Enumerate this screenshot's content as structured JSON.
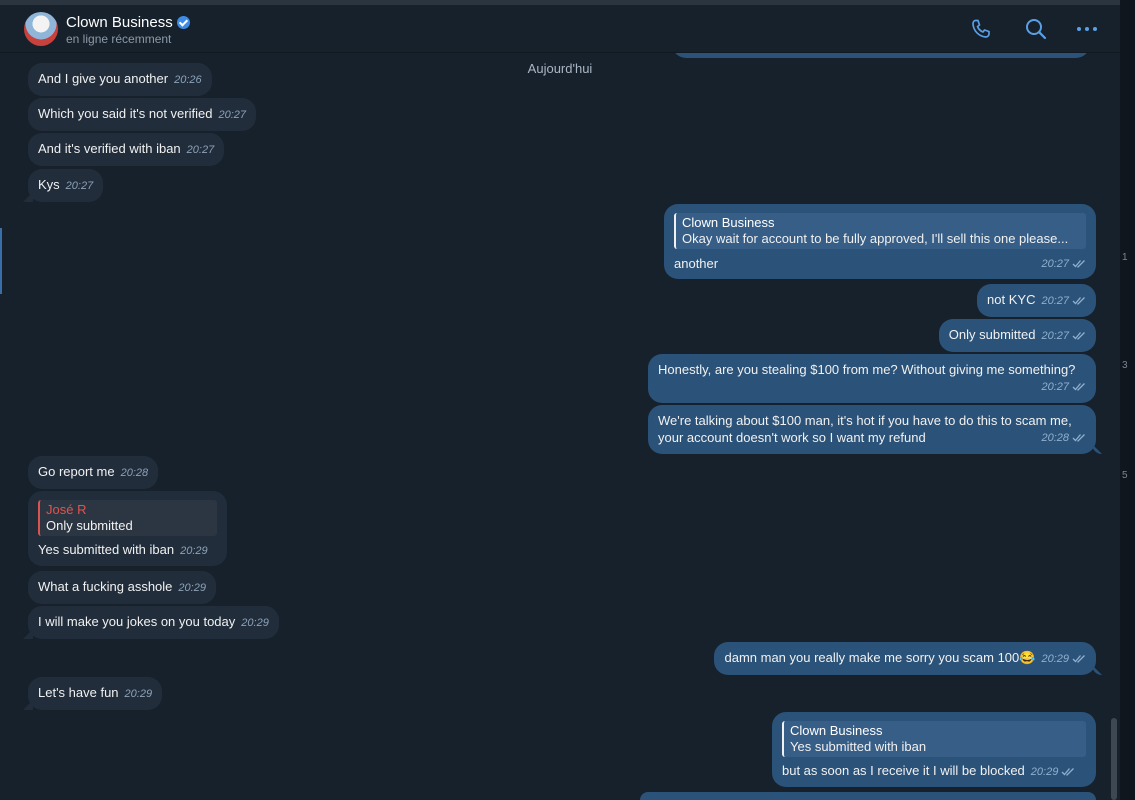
{
  "header": {
    "title": "Clown Business",
    "status": "en ligne récemment"
  },
  "icons": {
    "call": "phone-icon",
    "search": "search-icon",
    "more": "more-icon",
    "verified": "verified-badge-icon",
    "read": "double-check-icon"
  },
  "colors": {
    "background": "#17212b",
    "incoming_bubble": "#212d3b",
    "outgoing_bubble": "#2b5278",
    "accent": "#3c8ce7",
    "quote_name_incoming": "#e0544f"
  },
  "date_separator": "Aujourd'hui",
  "edge_text": [
    "1",
    "3",
    "5"
  ],
  "messages": [
    {
      "dir": "in",
      "text": "And I give you another",
      "time": "20:26"
    },
    {
      "dir": "in",
      "text": "Which you said it's not verified",
      "time": "20:27"
    },
    {
      "dir": "in",
      "text": "And it's verified with iban",
      "time": "20:27"
    },
    {
      "dir": "in",
      "text": "Kys",
      "time": "20:27"
    },
    {
      "dir": "out",
      "reply_name": "Clown Business",
      "reply_text": "Okay wait for account to be fully approved, I'll sell this one please...",
      "text": "another",
      "time": "20:27"
    },
    {
      "dir": "out",
      "text": "not KYC",
      "time": "20:27"
    },
    {
      "dir": "out",
      "text": "Only submitted",
      "time": "20:27"
    },
    {
      "dir": "out",
      "text": "Honestly, are you stealing $100 from me? Without giving me something?",
      "time": "20:27"
    },
    {
      "dir": "out",
      "text_line1": "We're talking about $100 man, it's hot if you have to do this to scam me,",
      "text_line2": "your account doesn't work so I want my refund",
      "time": "20:28"
    },
    {
      "dir": "in",
      "text": "Go report me",
      "time": "20:28"
    },
    {
      "dir": "in",
      "reply_name": "José R",
      "reply_text": "Only submitted",
      "text": "Yes submitted with iban",
      "time": "20:29"
    },
    {
      "dir": "in",
      "text": "What a fucking asshole",
      "time": "20:29"
    },
    {
      "dir": "in",
      "text": "I will make you jokes on you today",
      "time": "20:29"
    },
    {
      "dir": "out",
      "text": "damn man you really make me sorry you scam 100😂",
      "time": "20:29"
    },
    {
      "dir": "in",
      "text": "Let's have fun",
      "time": "20:29"
    },
    {
      "dir": "out",
      "reply_name": "Clown Business",
      "reply_text": "Yes submitted with iban",
      "text": "but as soon as I receive it I will be blocked",
      "time": "20:29"
    }
  ]
}
